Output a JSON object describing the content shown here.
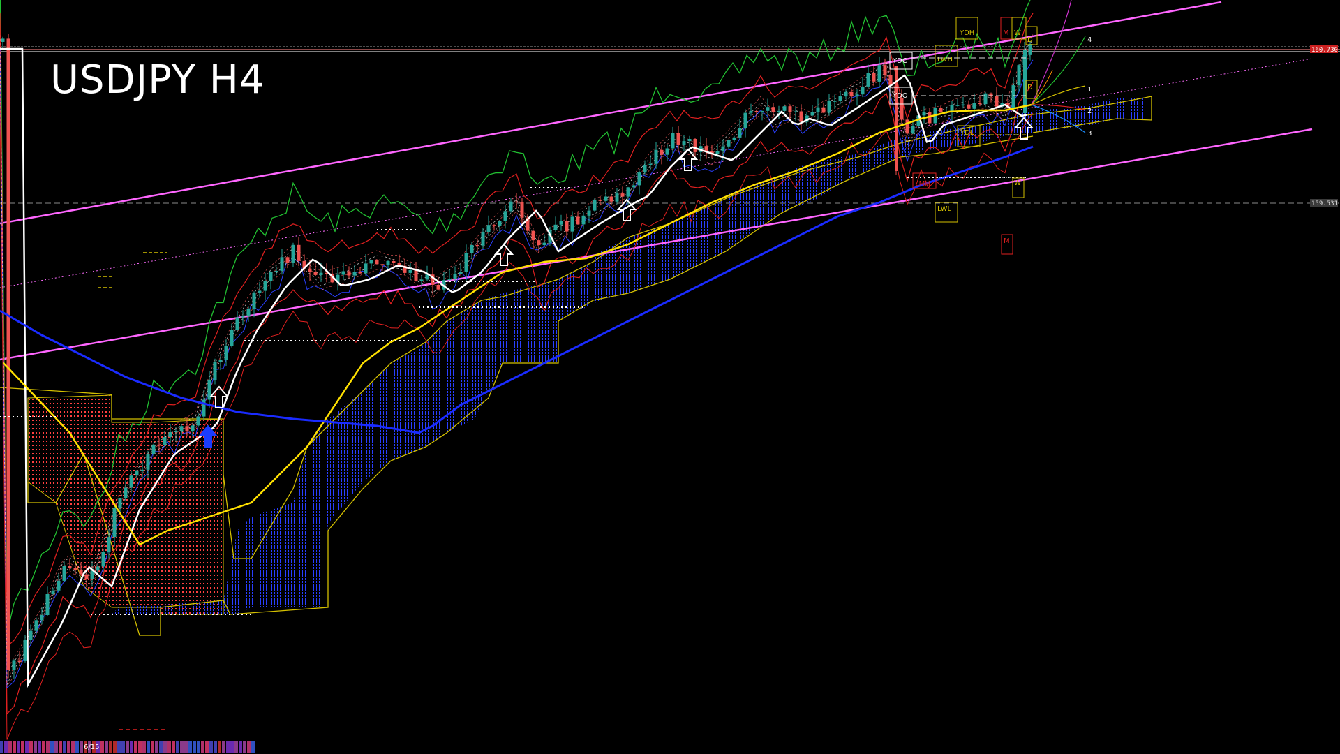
{
  "header": {
    "title": "USDJPY H4"
  },
  "colors": {
    "background": "#000000",
    "bull": "#26a69a",
    "bear": "#ef5350",
    "ma_white": "#ffffff",
    "ma_yellow": "#ffe000",
    "ma_blue": "#1a2bff",
    "channel": "#ff66ff",
    "cloud_blue": "#2a3fff",
    "cloud_red": "#ff4040",
    "span": "#d4c000",
    "green": "#22c032",
    "red": "#e02020"
  },
  "tags": {
    "ydh": "YDH",
    "m_top": "M",
    "w_top": "W",
    "d_top": "D",
    "ydc": "YDC",
    "lwh": "LWH",
    "ydo": "YDO",
    "ydl": "YDL",
    "d_mid": "D",
    "lmh": "LMH",
    "w_mid": "W",
    "lwl": "LWL",
    "m_low": "M"
  },
  "projection_labels": [
    "4",
    "1",
    "2",
    "3"
  ],
  "price_labels": {
    "upper": "160.730",
    "lower": "159.531"
  },
  "date_label": "6/15"
}
